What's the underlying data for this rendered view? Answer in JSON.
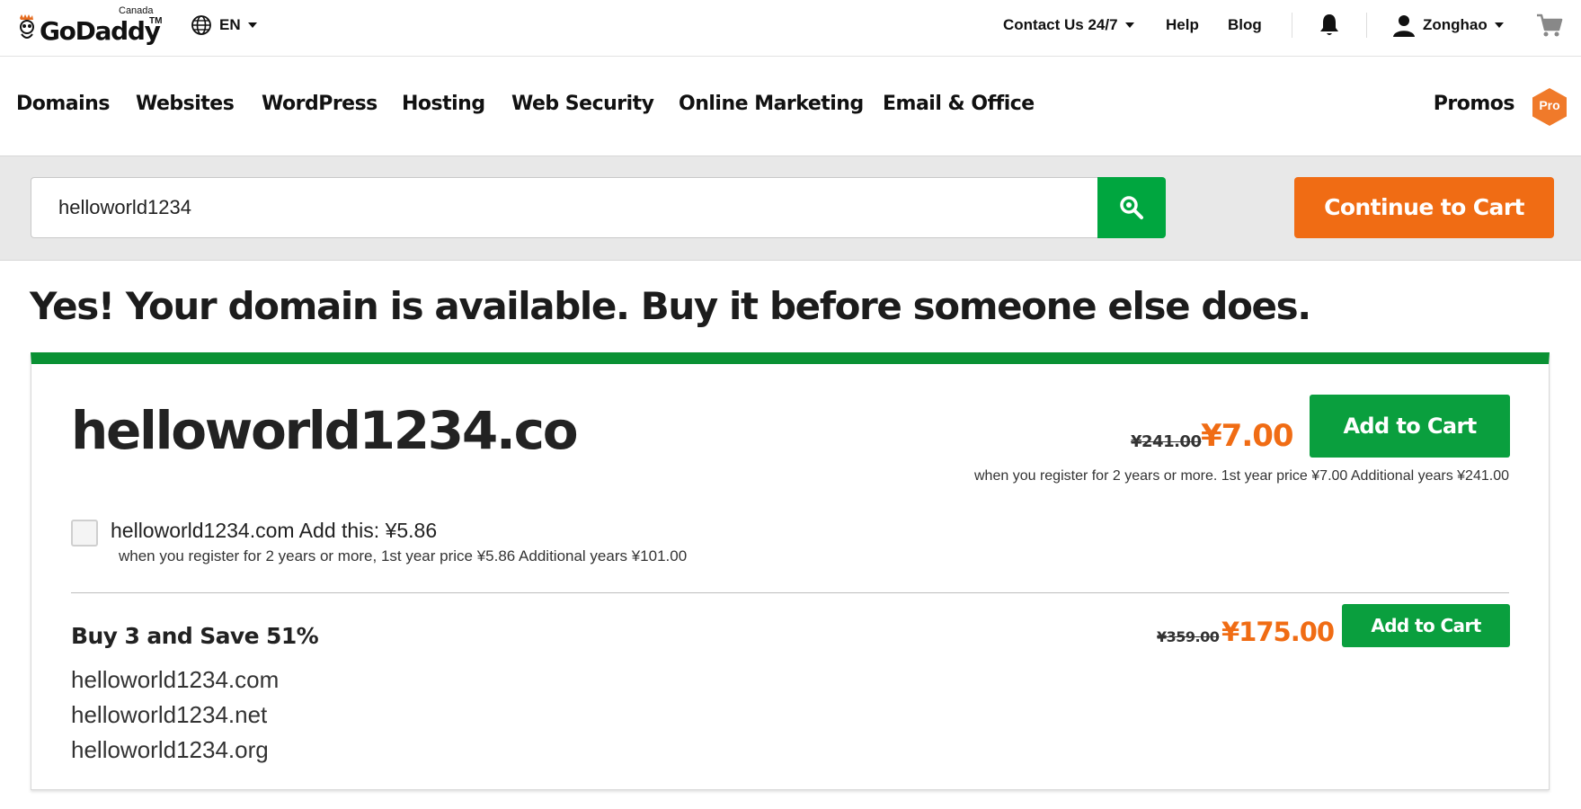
{
  "header": {
    "logo": {
      "wordmark": "GoDaddy",
      "trademark": "TM",
      "region": "Canada"
    },
    "language": {
      "label": "EN",
      "icon": "globe-icon"
    },
    "contact": "Contact Us 24/7",
    "help": "Help",
    "blog": "Blog",
    "notifications_icon": "bell-icon",
    "user": {
      "name": "Zonghao",
      "icon": "user-icon"
    },
    "cart_icon": "shopping-cart-icon"
  },
  "nav": {
    "items": [
      "Domains",
      "Websites",
      "WordPress",
      "Hosting",
      "Web Security",
      "Online Marketing",
      "Email & Office"
    ],
    "promos": "Promos",
    "pro_badge": "Pro"
  },
  "search": {
    "value": "helloworld1234",
    "button_icon": "search-icon",
    "continue_label": "Continue to Cart"
  },
  "headline": "Yes! Your domain is available. Buy it before someone else does.",
  "result": {
    "domain": "helloworld1234.co",
    "old_price": "¥241.00",
    "price": "¥7.00",
    "add_label": "Add to Cart",
    "note": "when you register for 2 years or more. 1st year price ¥7.00 Additional years ¥241.00",
    "addon": {
      "checked": false,
      "text": "helloworld1234.com Add this: ¥5.86",
      "note": "when you register for 2 years or more, 1st year price ¥5.86 Additional years ¥101.00"
    },
    "bundle": {
      "title": "Buy 3 and Save 51%",
      "old_price": "¥359.00",
      "price": "¥175.00",
      "add_label": "Add to Cart",
      "domains": [
        "helloworld1234.com",
        "helloworld1234.net",
        "helloworld1234.org"
      ]
    }
  },
  "colors": {
    "brand_green": "#0a9f3e",
    "card_accent": "#0a9134",
    "orange": "#f06c14",
    "search_band": "#e8e8e8"
  }
}
